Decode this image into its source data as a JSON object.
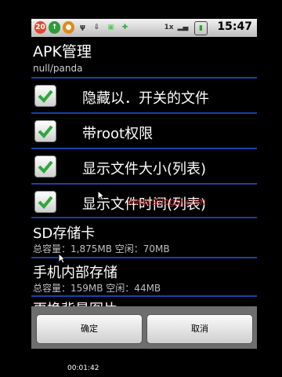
{
  "status_bar": {
    "time": "15:47",
    "notification_count": "20"
  },
  "header": {
    "title": "APK管理",
    "subtitle": "null/panda"
  },
  "options": [
    {
      "label": "隐藏以．开关的文件",
      "checked": true
    },
    {
      "label": "带root权限",
      "checked": true
    },
    {
      "label": "显示文件大小(列表)",
      "checked": true
    },
    {
      "label": "显示文件时间(列表)",
      "checked": true
    }
  ],
  "storage": {
    "sd": {
      "name": "SD存储卡",
      "detail": "总容量：1,875MB  空闲：70MB"
    },
    "internal": {
      "name": "手机内部存储",
      "detail": "总容量：159MB  空闲：44MB"
    },
    "next": {
      "name": "更换背景图片"
    }
  },
  "buttons": {
    "ok": "确定",
    "cancel": "取消"
  },
  "watermark": "www.9ilogsj.com",
  "video_timer": "00:01:42",
  "colors": {
    "separator": "#1e3fa8",
    "check": "#2ea83a"
  }
}
